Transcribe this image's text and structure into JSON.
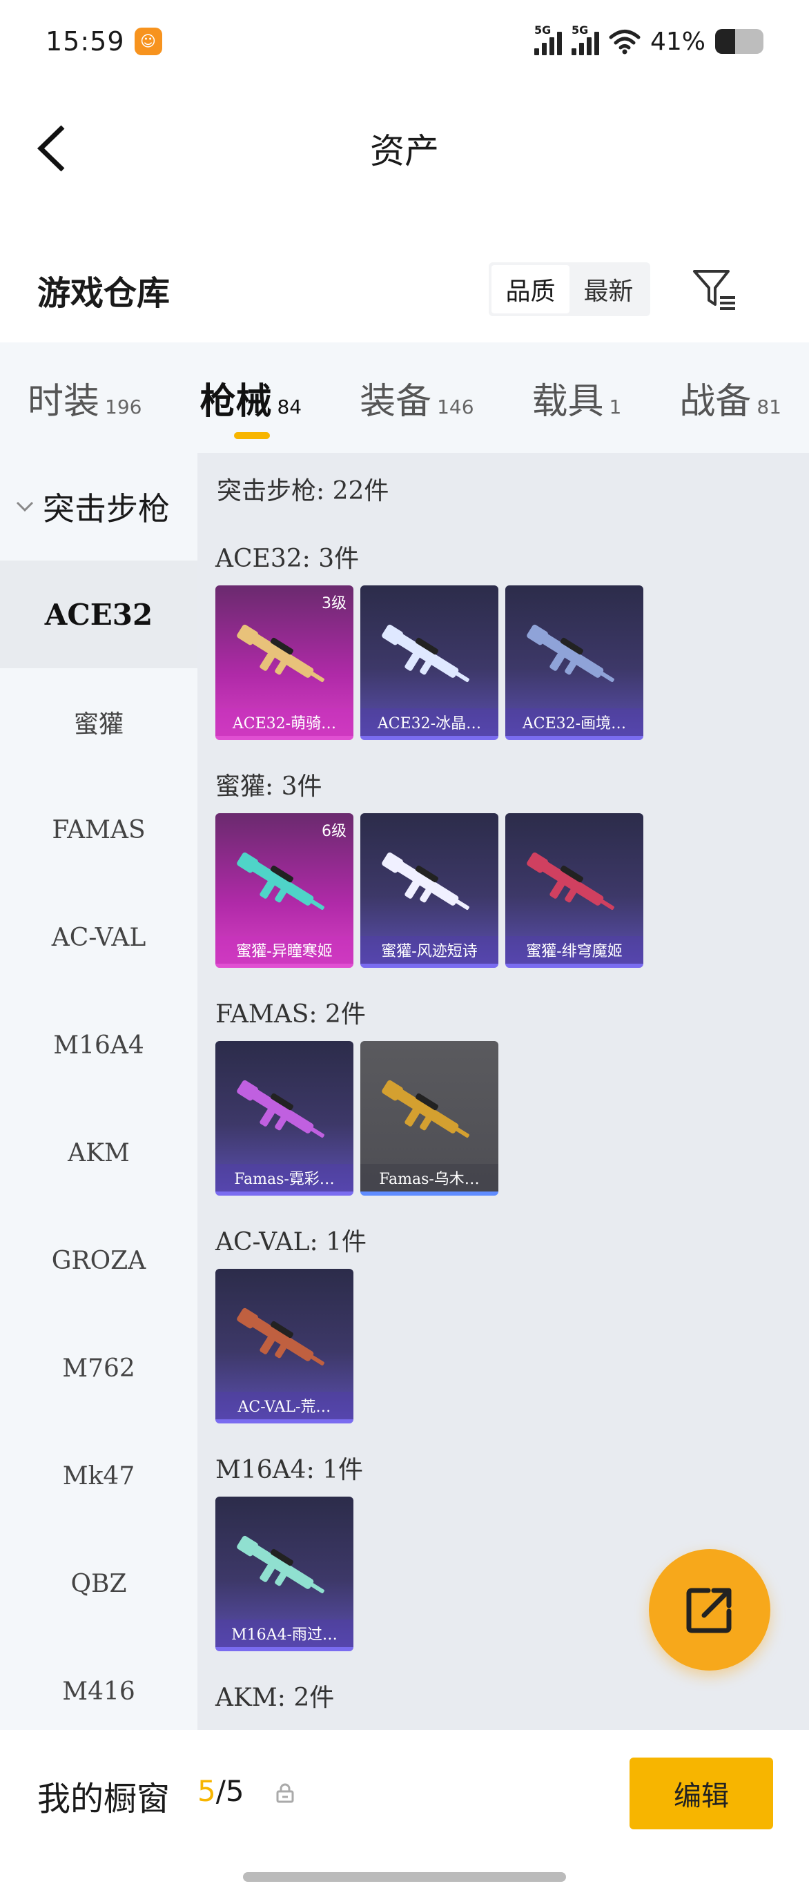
{
  "status": {
    "time": "15:59",
    "battery": "41%",
    "battery_level": 0.41,
    "signal1": "5G",
    "signal2": "5G",
    "app_icon": "app-icon"
  },
  "header": {
    "title": "资产"
  },
  "warehouse": {
    "title": "游戏仓库",
    "sort_options": [
      "品质",
      "最新"
    ],
    "active_sort": "品质"
  },
  "tabs": [
    {
      "label": "时装",
      "count": "196"
    },
    {
      "label": "枪械",
      "count": "84"
    },
    {
      "label": "装备",
      "count": "146"
    },
    {
      "label": "载具",
      "count": "1"
    },
    {
      "label": "战备",
      "count": "81"
    }
  ],
  "sidebar": {
    "group": "突击步枪",
    "items": [
      "ACE32",
      "蜜獾",
      "FAMAS",
      "AC-VAL",
      "M16A4",
      "AKM",
      "GROZA",
      "M762",
      "Mk47",
      "QBZ",
      "M416"
    ],
    "active": "ACE32"
  },
  "content": {
    "total": "突击步枪: 22件",
    "groups": [
      {
        "title": "ACE32: 3件",
        "cards": [
          {
            "name": "ACE32-萌骑…",
            "level": "3级",
            "style": "pink",
            "gun": "#e8c27a"
          },
          {
            "name": "ACE32-冰晶…",
            "level": "",
            "style": "purple",
            "gun": "#dfe8ff"
          },
          {
            "name": "ACE32-画境…",
            "level": "",
            "style": "purple",
            "gun": "#8fa3d8"
          }
        ]
      },
      {
        "title": "蜜獾: 3件",
        "cards": [
          {
            "name": "蜜獾-异瞳寒姬",
            "level": "6级",
            "style": "pink",
            "gun": "#4fd4c8"
          },
          {
            "name": "蜜獾-风迹短诗",
            "level": "",
            "style": "purple",
            "gun": "#f0f0ff"
          },
          {
            "name": "蜜獾-绯穹魔姬",
            "level": "",
            "style": "purple",
            "gun": "#d04060"
          }
        ]
      },
      {
        "title": "FAMAS: 2件",
        "cards": [
          {
            "name": "Famas-霓彩…",
            "level": "",
            "style": "purple",
            "gun": "#c060e0"
          },
          {
            "name": "Famas-乌木…",
            "level": "",
            "style": "gray",
            "gun": "#d4a030"
          }
        ]
      },
      {
        "title": "AC-VAL: 1件",
        "cards": [
          {
            "name": "AC-VAL-荒…",
            "level": "",
            "style": "purple",
            "gun": "#c06040"
          }
        ]
      },
      {
        "title": "M16A4: 1件",
        "cards": [
          {
            "name": "M16A4-雨过…",
            "level": "",
            "style": "purple",
            "gun": "#90e0d0"
          }
        ]
      },
      {
        "title": "AKM: 2件",
        "cards": []
      }
    ]
  },
  "bottom": {
    "showcase_label": "我的橱窗",
    "showcase_used": "5",
    "showcase_total": "/5",
    "edit_label": "编辑"
  },
  "colors": {
    "accent": "#f7b500",
    "fab": "#f7a81b"
  }
}
